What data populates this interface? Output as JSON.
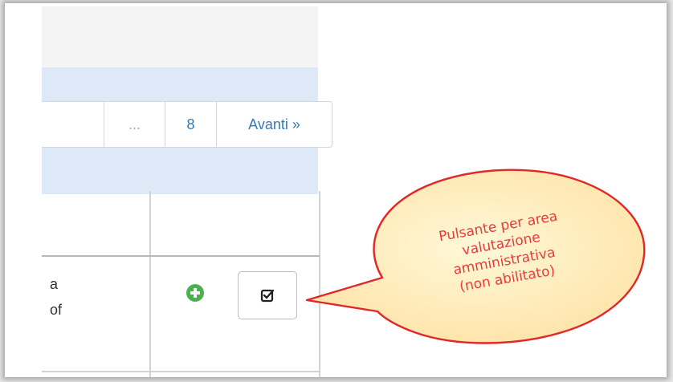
{
  "pagination": {
    "ellipsis": "...",
    "page_8": "8",
    "next": "Avanti »"
  },
  "row": {
    "text_line1": "a",
    "text_line2": "of"
  },
  "callout": {
    "line1": "Pulsante per area",
    "line2": "valutazione",
    "line3": "amministrativa",
    "line4": "(non abilitato)"
  },
  "colors": {
    "accent_blue": "#337ab7",
    "band_blue": "#dde9f7",
    "add_green": "#4caf50",
    "callout_fill": "#ffefbf",
    "callout_stroke": "#e02828",
    "callout_text": "#e83b3b"
  },
  "icons": {
    "add": "plus-circle-icon",
    "evaluate": "check-square-icon"
  }
}
